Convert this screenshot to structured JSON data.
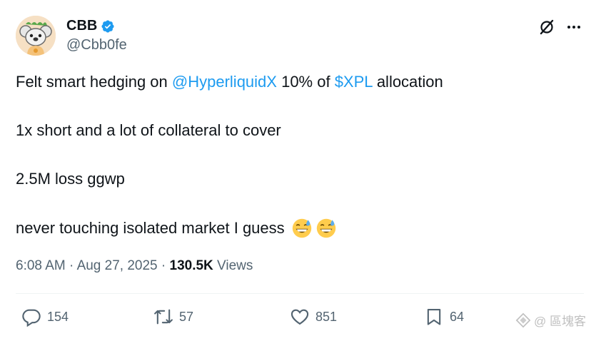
{
  "author": {
    "display_name": "CBB",
    "handle": "@Cbb0fe",
    "verified": true,
    "avatar_icon": "koala-cartoon-avatar"
  },
  "header_actions": {
    "grok_icon": "slashed-circle-icon",
    "more_icon": "more-horizontal-icon"
  },
  "tweet": {
    "line1_pre": "Felt smart hedging on ",
    "line1_mention": "@HyperliquidX",
    "line1_mid": " 10% of ",
    "line1_cashtag": "$XPL",
    "line1_post": " allocation",
    "line2": "1x short and a lot of collateral to cover",
    "line3": "2.5M loss ggwp",
    "line4": "never touching isolated market I guess",
    "emoji": [
      "grinning-sweat-emoji",
      "grinning-sweat-emoji"
    ]
  },
  "meta": {
    "time": "6:08 AM",
    "sep1": " · ",
    "date": "Aug 27, 2025",
    "sep2": " · ",
    "views_count": "130.5K",
    "views_label": " Views"
  },
  "actions": {
    "replies": "154",
    "reposts": "57",
    "likes": "851",
    "bookmarks": "64"
  },
  "watermark": {
    "text": "@ 區塊客",
    "icon": "diamond-logo-icon"
  },
  "colors": {
    "link": "#1d9bf0",
    "muted": "#536471",
    "text": "#0f1419",
    "verified": "#1d9bf0"
  }
}
